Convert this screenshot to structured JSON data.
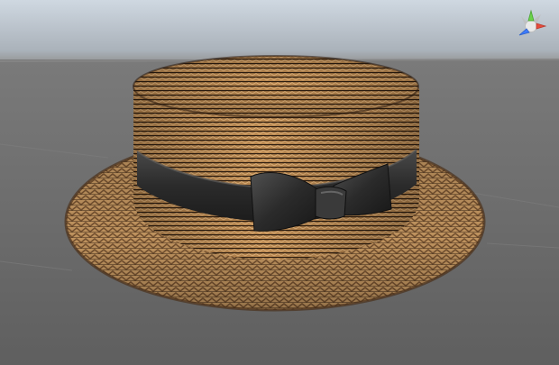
{
  "viewport": {
    "type": "3d-scene-view",
    "colors": {
      "sky_top": "#cfd8e1",
      "sky_bottom": "#9aa0a6",
      "horizon": "#8f8f8f",
      "ground": "#6a6a6a",
      "straw_light": "#c89a63",
      "straw_dark": "#5a3b20",
      "ribbon": "#2b2b2b",
      "ribbon_highlight": "#4a4a4a"
    }
  },
  "scene_gizmo": {
    "icon": "axis-orientation-gizmo",
    "x_color": "#e74c3c",
    "y_color": "#6bd34a",
    "z_color": "#3d7cff"
  },
  "object": {
    "icon": "boater-hat",
    "material": "woven-straw",
    "band": "black-ribbon-with-bow"
  }
}
